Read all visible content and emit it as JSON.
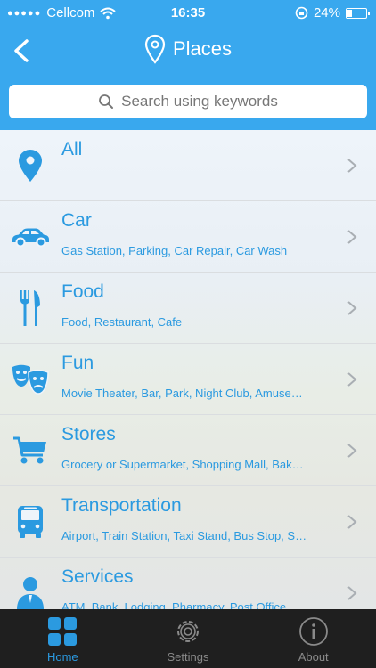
{
  "statusbar": {
    "carrier": "Cellcom",
    "time": "16:35",
    "battery": "24%",
    "battery_level": 0.24
  },
  "header": {
    "title": "Places",
    "back_icon": "chevron-left-icon",
    "title_icon": "map-pin-outline-icon"
  },
  "search": {
    "placeholder": "Search using keywords"
  },
  "categories": [
    {
      "name": "All",
      "desc": "",
      "icon": "map-pin-icon"
    },
    {
      "name": "Car",
      "desc": "Gas Station, Parking, Car Repair, Car Wash",
      "icon": "car-icon"
    },
    {
      "name": "Food",
      "desc": "Food, Restaurant, Cafe",
      "icon": "fork-knife-icon"
    },
    {
      "name": "Fun",
      "desc": "Movie Theater, Bar, Park, Night Club, Amuse…",
      "icon": "theater-masks-icon"
    },
    {
      "name": "Stores",
      "desc": "Grocery or Supermarket, Shopping Mall, Bak…",
      "icon": "shopping-cart-icon"
    },
    {
      "name": "Transportation",
      "desc": "Airport, Train Station, Taxi Stand, Bus Stop, S…",
      "icon": "bus-icon"
    },
    {
      "name": "Services",
      "desc": "ATM, Bank, Lodging, Pharmacy, Post Office,…",
      "icon": "person-icon"
    }
  ],
  "tabs": [
    {
      "label": "Home",
      "icon": "grid-icon",
      "active": true
    },
    {
      "label": "Settings",
      "icon": "gear-icon",
      "active": false
    },
    {
      "label": "About",
      "icon": "info-icon",
      "active": false
    }
  ],
  "colors": {
    "header": "#39a8ee",
    "accent": "#2b9ae0",
    "tabbar": "#1f1f1f"
  }
}
